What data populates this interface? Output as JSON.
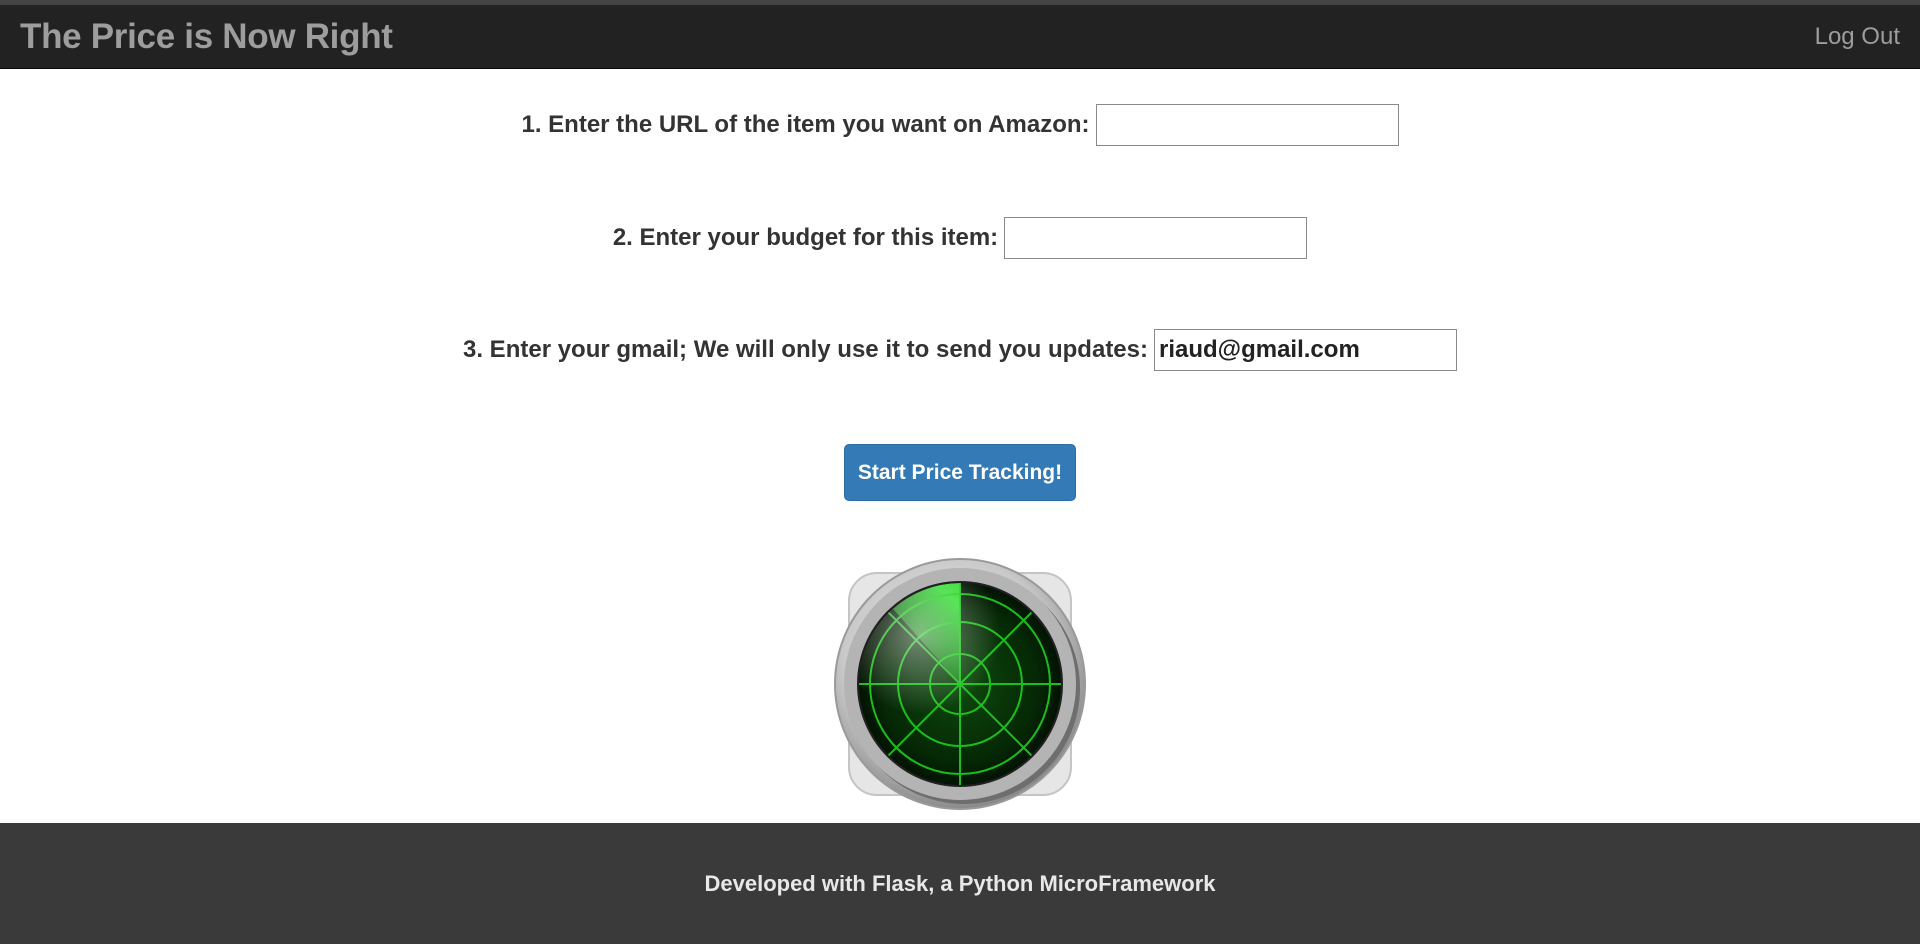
{
  "navbar": {
    "brand": "The Price is Now Right",
    "logout": "Log Out"
  },
  "form": {
    "url_label": "1. Enter the URL of the item you want on Amazon:",
    "url_value": "",
    "budget_label": "2. Enter your budget for this item:",
    "budget_value": "",
    "email_label": "3. Enter your gmail; We will only use it to send you updates:",
    "email_value": "riaud@gmail.com",
    "submit_label": "Start Price Tracking!"
  },
  "radar": {
    "icon": "radar-icon"
  },
  "footer": {
    "text": "Developed with Flask, a Python MicroFramework"
  },
  "colors": {
    "navbar_bg": "#222222",
    "navbar_text": "#9d9d9d",
    "button_bg": "#337ab7",
    "footer_bg": "#3a3a3a",
    "radar_green": "#1fd01f"
  }
}
